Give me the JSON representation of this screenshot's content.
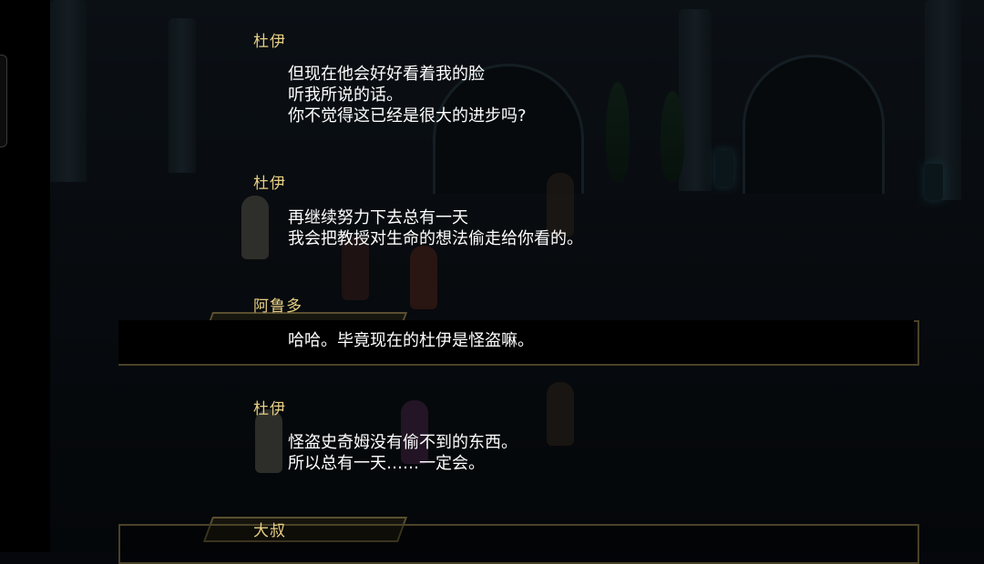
{
  "dialog_log": [
    {
      "speaker": "杜伊",
      "lines": [
        "但现在他会好好看着我的脸",
        "听我所说的话。",
        "你不觉得这已经是很大的进步吗?"
      ]
    },
    {
      "speaker": "杜伊",
      "lines": [
        "再继续努力下去总有一天",
        "我会把教授对生命的想法偷走给你看的。"
      ]
    },
    {
      "speaker": "阿鲁多",
      "lines": [
        "哈哈。毕竟现在的杜伊是怪盗嘛。"
      ]
    },
    {
      "speaker": "杜伊",
      "lines": [
        "怪盗史奇姆没有偷不到的东西。",
        "所以总有一天……一定会。"
      ]
    },
    {
      "speaker": "大叔",
      "lines": []
    }
  ]
}
